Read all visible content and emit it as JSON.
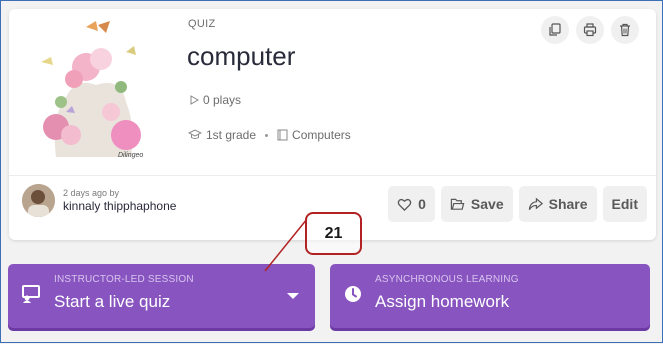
{
  "card": {
    "type_label": "QUIZ",
    "title": "computer",
    "plays": "0 plays",
    "grade": "1st grade",
    "subject": "Computers",
    "thumbnail_caption": "Dilingeo"
  },
  "author": {
    "time": "2 days ago by",
    "name": "kinnaly thipphaphone"
  },
  "actions": {
    "like_count": "0",
    "save_label": "Save",
    "share_label": "Share",
    "edit_label": "Edit"
  },
  "sessions": {
    "live": {
      "sub": "INSTRUCTOR-LED SESSION",
      "main": "Start a live quiz"
    },
    "homework": {
      "sub": "ASYNCHRONOUS LEARNING",
      "main": "Assign homework"
    }
  },
  "annotation": {
    "label": "21"
  },
  "colors": {
    "accent": "#8854c0",
    "annotation": "#b22222"
  }
}
